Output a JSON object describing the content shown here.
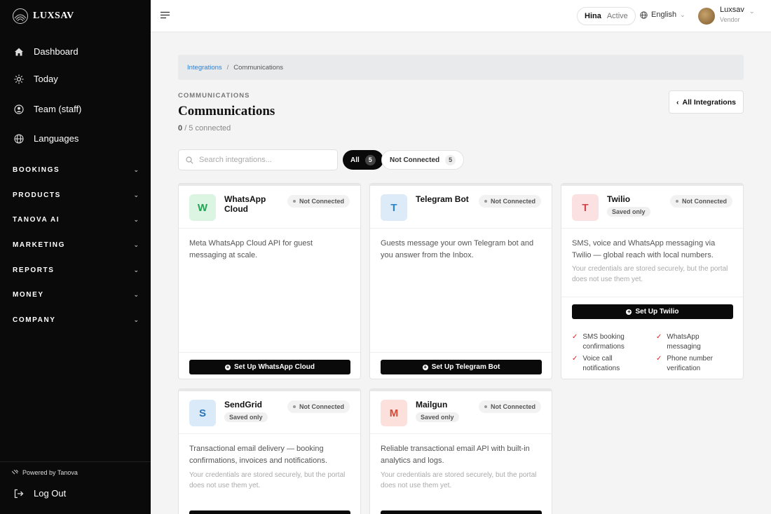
{
  "brand": {
    "name": "LUXSAV"
  },
  "sidebar": {
    "nav": [
      {
        "label": "Dashboard",
        "icon": "home-icon"
      },
      {
        "label": "Today",
        "icon": "sun-icon"
      },
      {
        "label": "Team (staff)",
        "icon": "team-icon"
      },
      {
        "label": "Languages",
        "icon": "globe-icon"
      }
    ],
    "sections": [
      "BOOKINGS",
      "PRODUCTS",
      "TANOVA AI",
      "MARKETING",
      "REPORTS",
      "MONEY",
      "COMPANY"
    ],
    "powered": "Powered by Tanova",
    "logout": "Log Out"
  },
  "topbar": {
    "status_name": "Hina",
    "status_state": "Active",
    "language": "English",
    "user_name": "Luxsav",
    "user_role": "Vendor"
  },
  "breadcrumb": {
    "parent": "Integrations",
    "sep": "/",
    "current": "Communications"
  },
  "page": {
    "eyebrow": "COMMUNICATIONS",
    "title": "Communications",
    "connected_count": "0",
    "connected_rest": "/ 5 connected",
    "all_integrations": "All Integrations"
  },
  "search": {
    "placeholder": "Search integrations..."
  },
  "filters": {
    "all_label": "All",
    "all_count": "5",
    "nc_label": "Not Connected",
    "nc_count": "5"
  },
  "cards": [
    {
      "letter": "W",
      "name": "WhatsApp Cloud",
      "status": "Not Connected",
      "desc": "Meta WhatsApp Cloud API for guest messaging at scale.",
      "button": "Set Up WhatsApp Cloud",
      "tile_bg": "#dcf5e3",
      "tile_fg": "#22a552"
    },
    {
      "letter": "T",
      "name": "Telegram Bot",
      "status": "Not Connected",
      "desc": "Guests message your own Telegram bot and you answer from the Inbox.",
      "button": "Set Up Telegram Bot",
      "tile_bg": "#dcebf7",
      "tile_fg": "#2a86c9"
    },
    {
      "letter": "T",
      "name": "Twilio",
      "saved": "Saved only",
      "status": "Not Connected",
      "desc": "SMS, voice and WhatsApp messaging via Twilio — global reach with local numbers.",
      "note": "Your credentials are stored securely, but the portal does not use them yet.",
      "button": "Set Up Twilio",
      "features": [
        "SMS booking confirmations",
        "WhatsApp messaging",
        "Voice call notifications",
        "Phone number verification"
      ],
      "tile_bg": "#fbe1e1",
      "tile_fg": "#d04545"
    },
    {
      "letter": "S",
      "name": "SendGrid",
      "saved": "Saved only",
      "status": "Not Connected",
      "desc": "Transactional email delivery — booking confirmations, invoices and notifications.",
      "note": "Your credentials are stored securely, but the portal does not use them yet.",
      "tile_bg": "#dbeaf8",
      "tile_fg": "#2a74b8"
    },
    {
      "letter": "M",
      "name": "Mailgun",
      "saved": "Saved only",
      "status": "Not Connected",
      "desc": "Reliable transactional email API with built-in analytics and logs.",
      "note": "Your credentials are stored securely, but the portal does not use them yet.",
      "tile_bg": "#fbe0dc",
      "tile_fg": "#d24a36"
    }
  ]
}
